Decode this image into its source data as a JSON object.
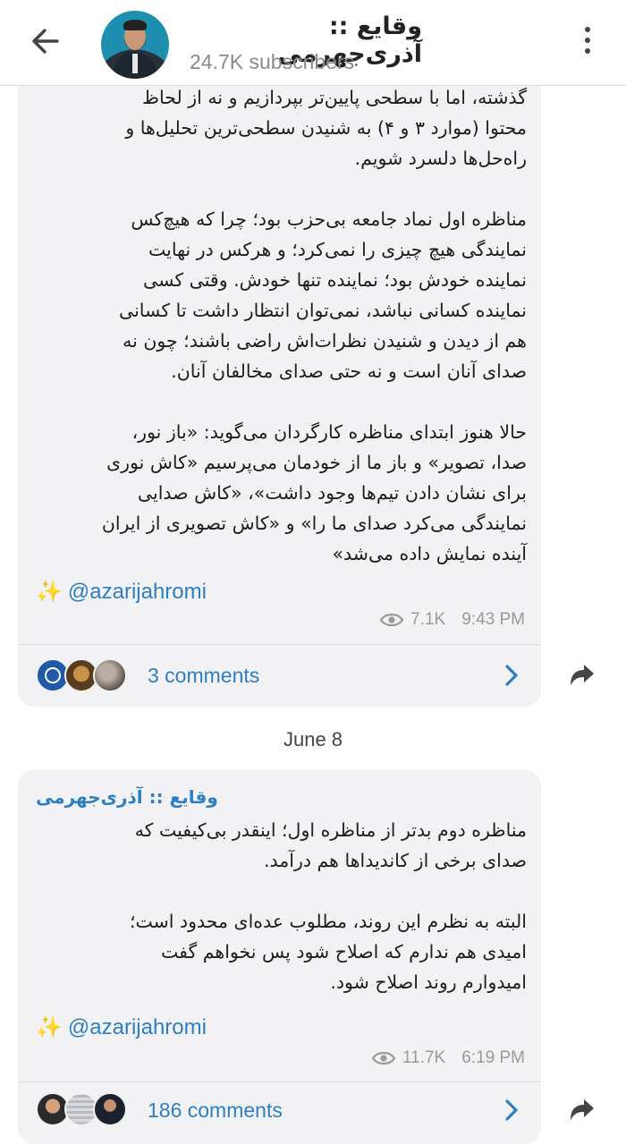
{
  "header": {
    "title": "وقایع :: آذری‌جهرمی",
    "subscribers": "24.7K subscribers"
  },
  "posts": [
    {
      "text_lines": [
        "گذشته، اما با سطحی پایین‌تر بپردازیم و نه از لحاظ",
        "محتوا (موارد ۳ و ۴) به شنیدن سطحی‌ترین تحلیل‌ها و",
        "راه‌حل‌ها دلسرد شویم.",
        "",
        "مناظره اول نماد جامعه بی‌حزب بود؛ چرا که هیچ‌کس",
        "نمایندگی هیچ چیزی را نمی‌کرد؛ و هرکس در نهایت",
        "نماینده خودش بود؛ نماینده تنها خودش. وقتی کسی",
        "نماینده کسانی نباشد، نمی‌توان انتظار داشت تا کسانی",
        "هم از دیدن و شنیدن نظرات‌اش راضی باشند؛ چون نه",
        "صدای آنان است و نه حتی صدای مخالفان آنان.",
        "",
        "حالا هنوز ابتدای مناظره کارگردان می‌گوید: «باز نور،",
        "صدا، تصویر» و باز ما از خودمان می‌پرسیم «کاش نوری",
        "برای نشان دادن تیم‌ها وجود داشت»، «کاش صدایی",
        "نمایندگی می‌کرد صدای ما را» و «کاش تصویری از ایران",
        "آینده نمایش داده می‌شد»"
      ],
      "handle": "@azarijahromi",
      "views": "7.1K",
      "time": "9:43 PM",
      "comments": "3 comments"
    },
    {
      "sender": "وقایع :: آذری‌جهرمی",
      "text_lines": [
        "مناظره دوم بدتر از مناظره اول؛ اینقدر بی‌کیفیت که",
        "صدای برخی از کاندیداها هم درآمد.",
        "",
        "البته به نظرم این روند، مطلوب عده‌ای محدود است؛",
        "امیدی هم ندارم که اصلاح شود پس نخواهم گفت",
        "امیدوارم روند اصلاح شود."
      ],
      "handle": "@azarijahromi",
      "views": "11.7K",
      "time": "6:19 PM",
      "comments": "186 comments"
    }
  ],
  "date_separator": "June 8",
  "colors": {
    "link": "#2c7fc0",
    "bubble": "#f2f2f4",
    "meta": "#9a9a9a"
  },
  "icons": [
    "back-arrow-icon",
    "more-vert-icon",
    "eye-icon",
    "sparkles-icon",
    "chevron-right-icon",
    "share-icon"
  ]
}
